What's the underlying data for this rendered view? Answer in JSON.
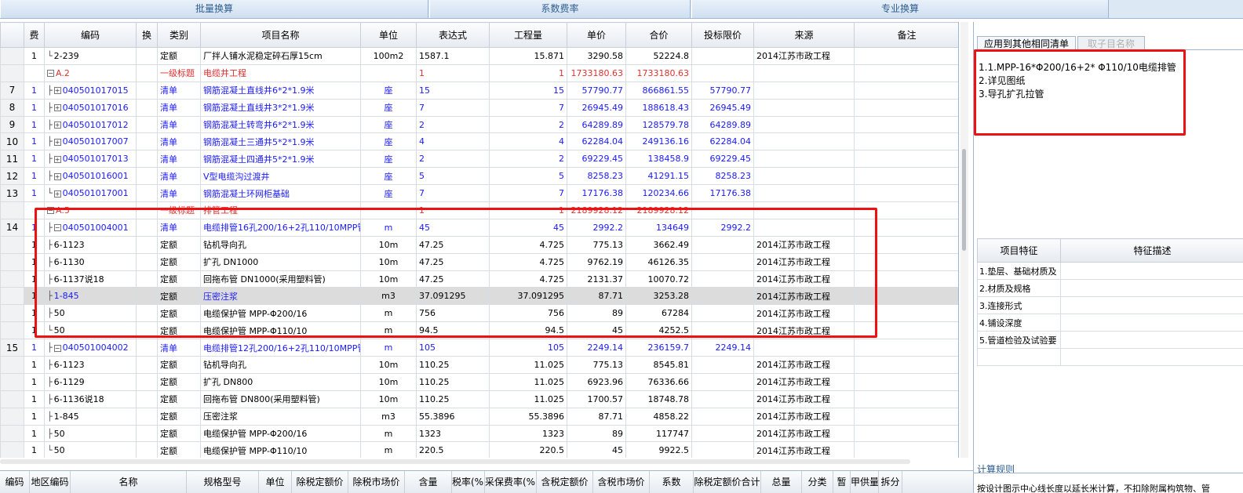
{
  "toolbar": {
    "batch_replace": "批量换算",
    "coef_fee": "系数费率",
    "special_replace": "专业换算"
  },
  "columns": [
    "费",
    "编码",
    "换",
    "类别",
    "项目名称",
    "单位",
    "表达式",
    "工程量",
    "单价",
    "合价",
    "投标限价",
    "来源",
    "备注"
  ],
  "rows": [
    {
      "rn": "",
      "fee": "1",
      "tree": "└",
      "box": "",
      "code": "2-239",
      "type": "定额",
      "name": "厂拌人铺水泥稳定碎石厚15cm",
      "unit": "100m2",
      "expr": "1587.1",
      "qty": "15.871",
      "price": "3290.58",
      "total": "52224.8",
      "limit": "",
      "source": "2014江苏市政工程",
      "style": "de"
    },
    {
      "rn": "",
      "fee": "",
      "tree": "",
      "box": "−",
      "code": "A.2",
      "type": "一级标题",
      "name": "电缆井工程",
      "unit": "",
      "expr": "1",
      "qty": "1",
      "price": "1733180.63",
      "total": "1733180.63",
      "limit": "",
      "source": "",
      "style": "lvl1"
    },
    {
      "rn": "7",
      "fee": "1",
      "tree": "├",
      "box": "+",
      "code": "040501017015",
      "type": "清单",
      "name": "钢筋混凝土直线井6*2*1.9米",
      "unit": "座",
      "expr": "15",
      "qty": "15",
      "price": "57790.77",
      "total": "866861.55",
      "limit": "57790.77",
      "source": "",
      "style": "qd"
    },
    {
      "rn": "8",
      "fee": "1",
      "tree": "├",
      "box": "+",
      "code": "040501017016",
      "type": "清单",
      "name": "钢筋混凝土直线井3*2*1.9米",
      "unit": "座",
      "expr": "7",
      "qty": "7",
      "price": "26945.49",
      "total": "188618.43",
      "limit": "26945.49",
      "source": "",
      "style": "qd"
    },
    {
      "rn": "9",
      "fee": "1",
      "tree": "├",
      "box": "+",
      "code": "040501017012",
      "type": "清单",
      "name": "钢筋混凝土转弯井6*2*1.9米",
      "unit": "座",
      "expr": "2",
      "qty": "2",
      "price": "64289.89",
      "total": "128579.78",
      "limit": "64289.89",
      "source": "",
      "style": "qd"
    },
    {
      "rn": "10",
      "fee": "1",
      "tree": "├",
      "box": "+",
      "code": "040501017007",
      "type": "清单",
      "name": "钢筋混凝土三通井5*2*1.9米",
      "unit": "座",
      "expr": "4",
      "qty": "4",
      "price": "62284.04",
      "total": "249136.16",
      "limit": "62284.04",
      "source": "",
      "style": "qd"
    },
    {
      "rn": "11",
      "fee": "1",
      "tree": "├",
      "box": "+",
      "code": "040501017013",
      "type": "清单",
      "name": "钢筋混凝土四通井5*2*1.9米",
      "unit": "座",
      "expr": "2",
      "qty": "2",
      "price": "69229.45",
      "total": "138458.9",
      "limit": "69229.45",
      "source": "",
      "style": "qd"
    },
    {
      "rn": "12",
      "fee": "1",
      "tree": "├",
      "box": "+",
      "code": "040501016001",
      "type": "清单",
      "name": "V型电缆沟过渡井",
      "unit": "座",
      "expr": "5",
      "qty": "5",
      "price": "8258.23",
      "total": "41291.15",
      "limit": "8258.23",
      "source": "",
      "style": "qd"
    },
    {
      "rn": "13",
      "fee": "1",
      "tree": "└",
      "box": "+",
      "code": "040501017001",
      "type": "清单",
      "name": "钢筋混凝土环网柜基础",
      "unit": "座",
      "expr": "7",
      "qty": "7",
      "price": "17176.38",
      "total": "120234.66",
      "limit": "17176.38",
      "source": "",
      "style": "qd"
    },
    {
      "rn": "",
      "fee": "",
      "tree": "",
      "box": "−",
      "code": "A.5",
      "type": "一级标题",
      "name": "排管工程",
      "unit": "",
      "expr": "1",
      "qty": "1",
      "price": "2189928.12",
      "total": "2189928.12",
      "limit": "",
      "source": "",
      "style": "lvl1"
    },
    {
      "rn": "14",
      "fee": "1",
      "tree": "├",
      "box": "−",
      "code": "040501004001",
      "type": "清单",
      "name": "电缆排管16孔200/16+2孔110/10MPP管",
      "unit": "m",
      "expr": "45",
      "qty": "45",
      "price": "2992.2",
      "total": "134649",
      "limit": "2992.2",
      "source": "",
      "style": "qd"
    },
    {
      "rn": "",
      "fee": "1",
      "tree": "├",
      "box": "",
      "code": "6-1123",
      "type": "定额",
      "name": "钻机导向孔",
      "unit": "10m",
      "expr": "47.25",
      "qty": "4.725",
      "price": "775.13",
      "total": "3662.49",
      "limit": "",
      "source": "2014江苏市政工程",
      "style": "de"
    },
    {
      "rn": "",
      "fee": "1",
      "tree": "├",
      "box": "",
      "code": "6-1130",
      "type": "定额",
      "name": "扩孔 DN1000",
      "unit": "10m",
      "expr": "47.25",
      "qty": "4.725",
      "price": "9762.19",
      "total": "46126.35",
      "limit": "",
      "source": "2014江苏市政工程",
      "style": "de"
    },
    {
      "rn": "",
      "fee": "1",
      "tree": "├",
      "box": "",
      "code": "6-1137说18",
      "type": "定额",
      "name": "回拖布管 DN1000(采用塑料管)",
      "unit": "10m",
      "expr": "47.25",
      "qty": "4.725",
      "price": "2131.37",
      "total": "10070.72",
      "limit": "",
      "source": "2014江苏市政工程",
      "style": "de"
    },
    {
      "rn": "",
      "fee": "1",
      "tree": "├",
      "box": "",
      "code": "1-845",
      "type": "定额",
      "name": "压密注浆",
      "unit": "m3",
      "expr": "37.091295",
      "qty": "37.091295",
      "price": "87.71",
      "total": "3253.28",
      "limit": "",
      "source": "2014江苏市政工程",
      "style": "sel"
    },
    {
      "rn": "",
      "fee": "1",
      "tree": "├",
      "box": "",
      "code": "50",
      "type": "定额",
      "name": "电缆保护管 MPP-Φ200/16",
      "unit": "m",
      "expr": "756",
      "qty": "756",
      "price": "89",
      "total": "67284",
      "limit": "",
      "source": "2014江苏市政工程",
      "style": "de"
    },
    {
      "rn": "",
      "fee": "1",
      "tree": "└",
      "box": "",
      "code": "50",
      "type": "定额",
      "name": "电缆保护管 MPP-Φ110/10",
      "unit": "m",
      "expr": "94.5",
      "qty": "94.5",
      "price": "45",
      "total": "4252.5",
      "limit": "",
      "source": "2014江苏市政工程",
      "style": "de"
    },
    {
      "rn": "15",
      "fee": "1",
      "tree": "├",
      "box": "−",
      "code": "040501004002",
      "type": "清单",
      "name": "电缆排管12孔200/16+2孔110/10MPP管",
      "unit": "m",
      "expr": "105",
      "qty": "105",
      "price": "2249.14",
      "total": "236159.7",
      "limit": "2249.14",
      "source": "",
      "style": "qd"
    },
    {
      "rn": "",
      "fee": "1",
      "tree": "├",
      "box": "",
      "code": "6-1123",
      "type": "定额",
      "name": "钻机导向孔",
      "unit": "10m",
      "expr": "110.25",
      "qty": "11.025",
      "price": "775.13",
      "total": "8545.81",
      "limit": "",
      "source": "2014江苏市政工程",
      "style": "de"
    },
    {
      "rn": "",
      "fee": "1",
      "tree": "├",
      "box": "",
      "code": "6-1129",
      "type": "定额",
      "name": "扩孔 DN800",
      "unit": "10m",
      "expr": "110.25",
      "qty": "11.025",
      "price": "6923.96",
      "total": "76336.66",
      "limit": "",
      "source": "2014江苏市政工程",
      "style": "de"
    },
    {
      "rn": "",
      "fee": "1",
      "tree": "├",
      "box": "",
      "code": "6-1136说18",
      "type": "定额",
      "name": "回拖布管 DN800(采用塑料管)",
      "unit": "10m",
      "expr": "110.25",
      "qty": "11.025",
      "price": "1700.57",
      "total": "18748.78",
      "limit": "",
      "source": "2014江苏市政工程",
      "style": "de"
    },
    {
      "rn": "",
      "fee": "1",
      "tree": "├",
      "box": "",
      "code": "1-845",
      "type": "定额",
      "name": "压密注浆",
      "unit": "m3",
      "expr": "55.3896",
      "qty": "55.3896",
      "price": "87.71",
      "total": "4858.22",
      "limit": "",
      "source": "2014江苏市政工程",
      "style": "de"
    },
    {
      "rn": "",
      "fee": "1",
      "tree": "├",
      "box": "",
      "code": "50",
      "type": "定额",
      "name": "电缆保护管 MPP-Φ200/16",
      "unit": "m",
      "expr": "1323",
      "qty": "1323",
      "price": "89",
      "total": "117747",
      "limit": "",
      "source": "2014江苏市政工程",
      "style": "de"
    },
    {
      "rn": "",
      "fee": "1",
      "tree": "└",
      "box": "",
      "code": "50",
      "type": "定额",
      "name": "电缆保护管 MPP-Φ110/10",
      "unit": "m",
      "expr": "220.5",
      "qty": "220.5",
      "price": "45",
      "total": "9922.5",
      "limit": "",
      "source": "2014江苏市政工程",
      "style": "de"
    }
  ],
  "right_panel": {
    "tab_apply": "应用到其他相同清单",
    "tab_subitem": "取子目名称",
    "desc_lines": [
      "1.1.MPP-16*Φ200/16+2* Φ110/10电缆排管",
      "2.详见图纸",
      "3.导孔扩孔拉管"
    ],
    "feature_header": "项目特征",
    "desc_header": "特征描述",
    "features": [
      "1.垫层、基础材质及",
      "2.材质及规格",
      "3.连接形式",
      "4.铺设深度",
      "5.管道检验及试验要"
    ],
    "calc_rule_title": "计算规则",
    "calc_rule_text": "按设计图示中心线长度以延长米计算，不扣除附属构筑物、管"
  },
  "bottom_columns": [
    "编码",
    "地区编码",
    "名称",
    "规格型号",
    "单位",
    "除税定额价",
    "除税市场价",
    "含量",
    "税率(%)",
    "采保费率(%)",
    "含税定额价",
    "含税市场价",
    "系数",
    "除税定额价合计",
    "总量",
    "分类",
    "暂",
    "甲供量",
    "拆分"
  ],
  "colors": {
    "accent": "#2f5e8f",
    "annotation_red": "#ee1111",
    "qd_blue": "#1a1aff",
    "title_red": "#e03030"
  }
}
